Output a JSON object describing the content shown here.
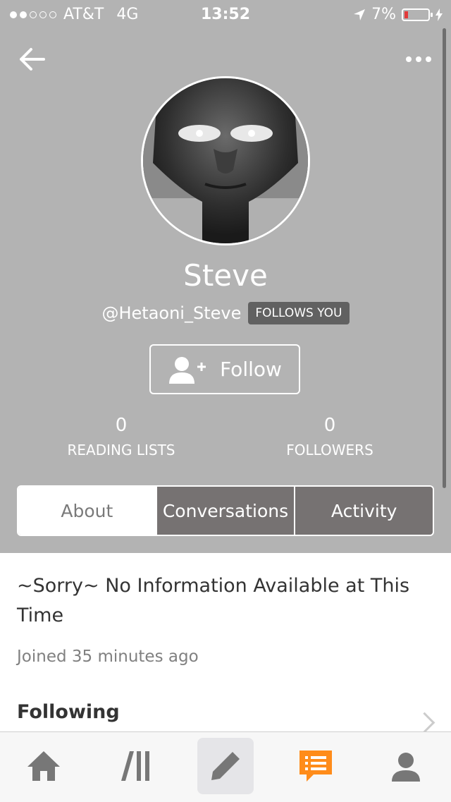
{
  "status_bar": {
    "carrier": "AT&T",
    "network": "4G",
    "time": "13:52",
    "battery": "7%",
    "signal_bars_filled": 2,
    "signal_bars_total": 5
  },
  "profile": {
    "name": "Steve",
    "handle": "@Hetaoni_Steve",
    "follows_badge": "FOLLOWS YOU",
    "follow_label": "Follow"
  },
  "stats": {
    "reading_lists": {
      "value": "0",
      "label": "READING LISTS"
    },
    "followers": {
      "value": "0",
      "label": "FOLLOWERS"
    }
  },
  "tabs": [
    {
      "label": "About",
      "active": true
    },
    {
      "label": "Conversations",
      "active": false
    },
    {
      "label": "Activity",
      "active": false
    }
  ],
  "about": {
    "description": "~Sorry~ No Information Available at This Time",
    "joined": "Joined 35 minutes ago",
    "following_label": "Following"
  },
  "nav": {
    "items": [
      "home-icon",
      "library-icon",
      "write-icon",
      "messages-icon",
      "profile-icon"
    ],
    "selected": "write-icon"
  },
  "colors": {
    "header_bg": "#b3b3b3",
    "accent": "#ff8c1a",
    "tab_inactive": "#767272",
    "badge_bg": "#616161"
  }
}
